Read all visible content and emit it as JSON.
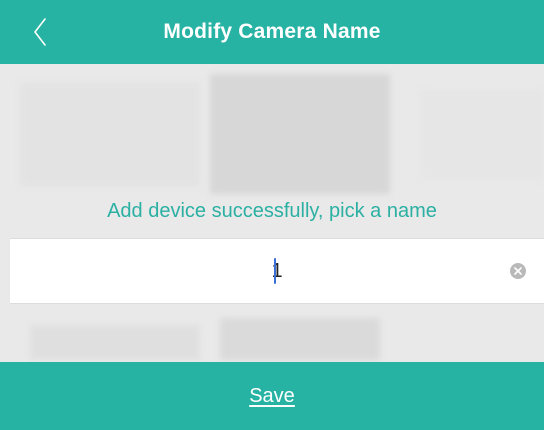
{
  "header": {
    "title": "Modify Camera Name",
    "back_icon": "chevron-left-icon"
  },
  "form": {
    "prompt": "Add device successfully, pick a name",
    "name_value": "1",
    "clear_icon": "clear-circle-icon"
  },
  "footer": {
    "save_label": "Save"
  },
  "colors": {
    "accent": "#26b3a4",
    "prompt_text": "#2bb0a3",
    "background": "#e9e9e9",
    "caret": "#3a6fd8"
  }
}
